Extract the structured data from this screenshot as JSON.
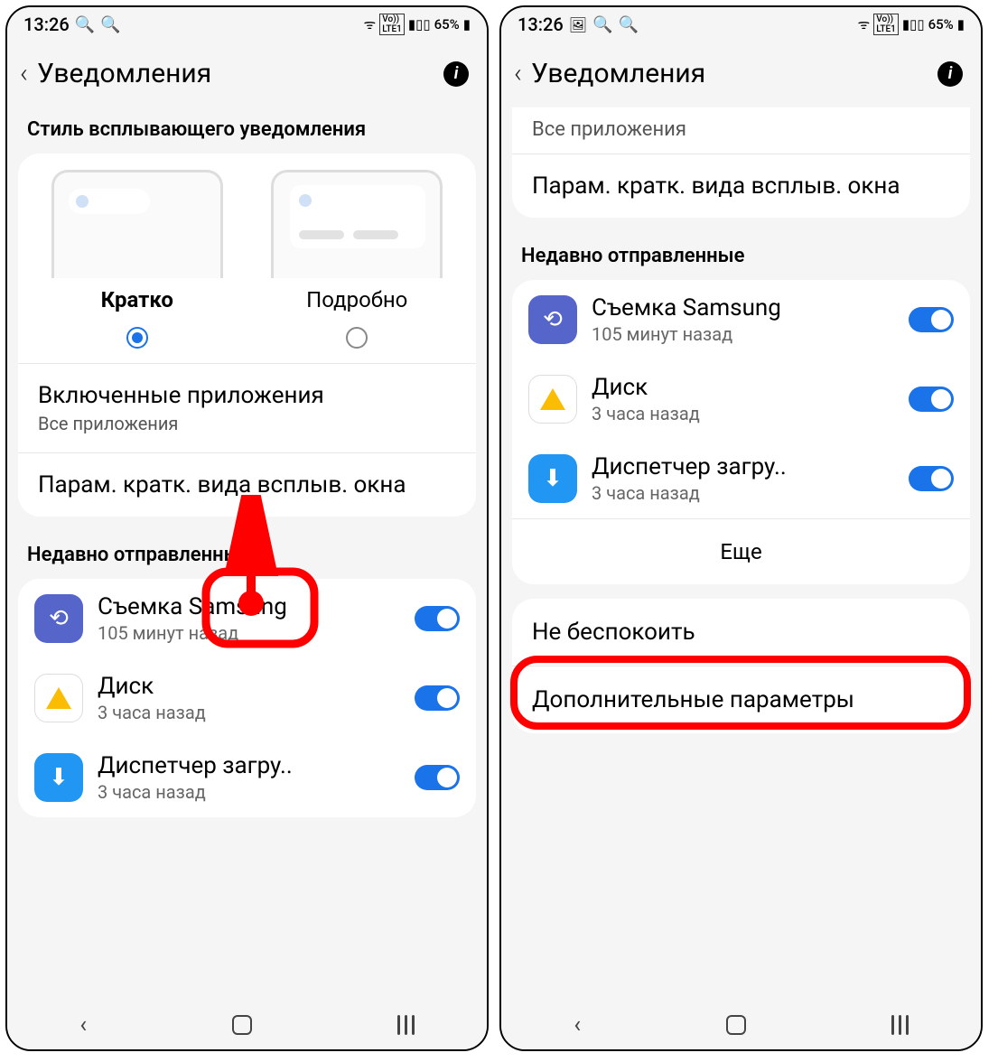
{
  "statusbar": {
    "time": "13:26",
    "battery": "65%"
  },
  "header": {
    "title": "Уведомления"
  },
  "left": {
    "style_heading": "Стиль всплывающего уведомления",
    "opt_brief": "Кратко",
    "opt_detail": "Подробно",
    "included_apps_title": "Включенные приложения",
    "included_apps_sub": "Все приложения",
    "popup_params": "Парам. кратк. вида всплыв. окна",
    "recent_heading": "Недавно отправленные",
    "apps": [
      {
        "name": "Съемка Samsung",
        "time": "105 минут назад"
      },
      {
        "name": "Диск",
        "time": "3 часа назад"
      },
      {
        "name": "Диспетчер загру..",
        "time": "3 часа назад"
      }
    ]
  },
  "right": {
    "all_apps": "Все приложения",
    "popup_params": "Парам. кратк. вида всплыв. окна",
    "recent_heading": "Недавно отправленные",
    "apps": [
      {
        "name": "Съемка Samsung",
        "time": "105 минут назад"
      },
      {
        "name": "Диск",
        "time": "3 часа назад"
      },
      {
        "name": "Диспетчер загру..",
        "time": "3 часа назад"
      }
    ],
    "more": "Еще",
    "dnd": "Не беспокоить",
    "advanced": "Дополнительные параметры"
  }
}
